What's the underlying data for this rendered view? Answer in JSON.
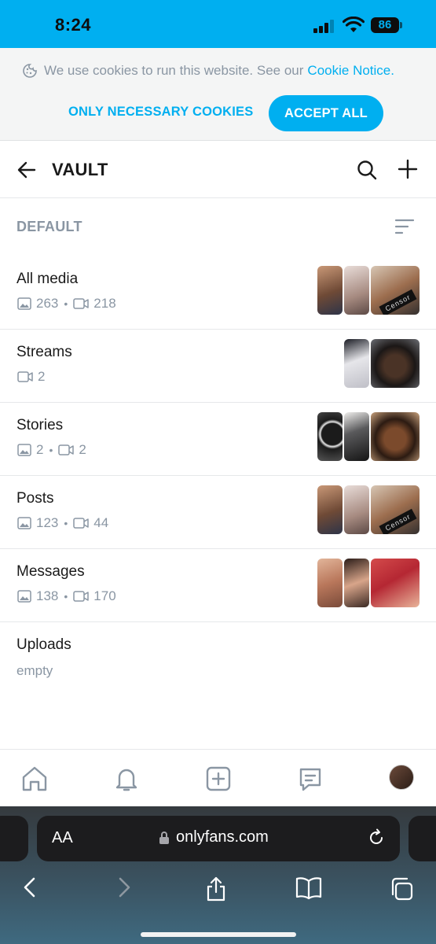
{
  "status_bar": {
    "time": "8:24",
    "battery": "86"
  },
  "cookie_banner": {
    "message": "We use cookies to run this website. See our",
    "link": "Cookie Notice.",
    "necessary_label": "ONLY NECESSARY COOKIES",
    "accept_label": "ACCEPT ALL",
    "icon": "cookie-icon"
  },
  "header": {
    "title": "VAULT"
  },
  "section": {
    "label": "DEFAULT"
  },
  "lists": [
    {
      "title": "All media",
      "photos": "263",
      "videos": "218"
    },
    {
      "title": "Streams",
      "videos": "2"
    },
    {
      "title": "Stories",
      "photos": "2",
      "videos": "2"
    },
    {
      "title": "Posts",
      "photos": "123",
      "videos": "44"
    },
    {
      "title": "Messages",
      "photos": "138",
      "videos": "170"
    },
    {
      "title": "Uploads",
      "empty": "empty"
    }
  ],
  "thumb_overlay": "Censor",
  "safari": {
    "aa": "AA",
    "url": "onlyfans.com"
  },
  "colors": {
    "accent": "#00aff0",
    "muted": "#8a96a3",
    "text": "#1a1a1a"
  }
}
